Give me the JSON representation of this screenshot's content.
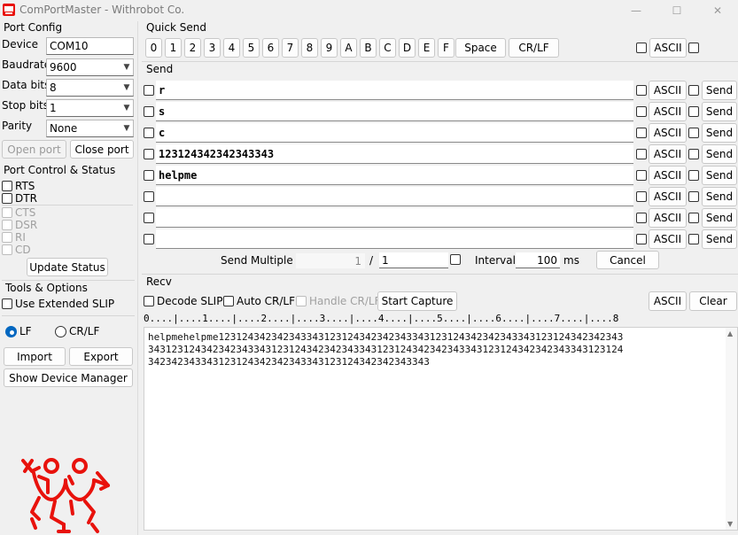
{
  "window": {
    "title": "ComPortMaster - Withrobot Co.",
    "controls": [
      "—",
      "☐",
      "✕"
    ]
  },
  "port_config": {
    "section": "Port Config",
    "device_label": "Device",
    "device_value": "COM10",
    "baud_label": "Baudrate",
    "baud_value": "9600",
    "databits_label": "Data bits",
    "databits_value": "8",
    "stopbits_label": "Stop bits",
    "stopbits_value": "1",
    "parity_label": "Parity",
    "parity_value": "None",
    "open_label": "Open port",
    "close_label": "Close port"
  },
  "port_control": {
    "section": "Port Control & Status",
    "rts": "RTS",
    "dtr": "DTR",
    "cts": "CTS",
    "dsr": "DSR",
    "ri": "RI",
    "cd": "CD",
    "update_label": "Update Status"
  },
  "tools": {
    "section": "Tools & Options",
    "slip_label": "Use Extended SLIP",
    "lf_label": "LF",
    "crlf_label": "CR/LF",
    "import_label": "Import",
    "export_label": "Export",
    "device_manager_label": "Show Device Manager"
  },
  "quick_send": {
    "section": "Quick Send",
    "keys": [
      "0",
      "1",
      "2",
      "3",
      "4",
      "5",
      "6",
      "7",
      "8",
      "9",
      "A",
      "B",
      "C",
      "D",
      "E",
      "F"
    ],
    "space_label": "Space",
    "crlf_label": "CR/LF",
    "ascii_label": "ASCII"
  },
  "send": {
    "section": "Send",
    "ascii_label": "ASCII",
    "send_label": "Send",
    "rows": [
      "r",
      "s",
      "c",
      "123124342342343343",
      "helpme",
      "",
      "",
      ""
    ],
    "multiple_label": "Send Multiple :",
    "multiple_current": "1",
    "multiple_sep": "/",
    "multiple_total": "1",
    "interval_label": "Interval",
    "interval_value": "100",
    "interval_unit": "ms",
    "cancel_label": "Cancel"
  },
  "recv": {
    "section": "Recv",
    "decode_slip_label": "Decode SLIP",
    "auto_crlf_label": "Auto CR/LF",
    "handle_crlf_label": "Handle CR/LF",
    "start_capture_label": "Start Capture",
    "ascii_label": "ASCII",
    "clear_label": "Clear",
    "ruler": "0....|....1....|....2....|....3....|....4....|....5....|....6....|....7....|....8",
    "lines": [
      "helpmehelpme123124342342343343123124342342343343123124342342343343123124342342343",
      "343123124342342343343123124342342343343123124342342343343123124342342343343123124",
      "342342343343123124342342343343123124342342343343"
    ]
  },
  "colors": {
    "logo_red": "#e8120c",
    "radio_blue": "#0067c0"
  }
}
